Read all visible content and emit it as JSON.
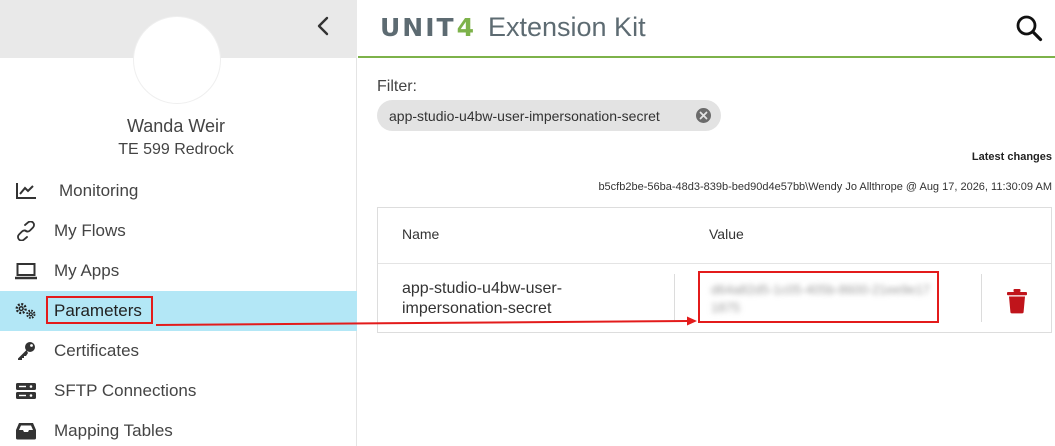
{
  "app": {
    "brand_unit": "UNIT",
    "brand_four": "4",
    "title": "Extension Kit"
  },
  "user": {
    "name": "Wanda Weir",
    "org": "TE 599 Redrock"
  },
  "nav": {
    "items": [
      {
        "label": "Monitoring",
        "icon": "chart-line-icon"
      },
      {
        "label": "My Flows",
        "icon": "link-icon"
      },
      {
        "label": "My Apps",
        "icon": "laptop-icon"
      },
      {
        "label": "Parameters",
        "icon": "gears-icon",
        "active": true
      },
      {
        "label": "Certificates",
        "icon": "key-icon"
      },
      {
        "label": "SFTP Connections",
        "icon": "server-icon"
      },
      {
        "label": "Mapping Tables",
        "icon": "tray-icon"
      }
    ]
  },
  "filter": {
    "label": "Filter:",
    "chip_value": "app-studio-u4bw-user-impersonation-secret"
  },
  "latest_changes": {
    "title": "Latest changes",
    "info": "b5cfb2be-56ba-48d3-839b-bed90d4e57bb\\Wendy Jo Allthrope @ Aug 17, 2026, 11:30:09 AM"
  },
  "table": {
    "columns": [
      "Name",
      "Value"
    ],
    "rows": [
      {
        "name": "app-studio-u4bw-user-impersonation-secret",
        "value": "d64a82d5-1c05-405b-8600-21ee9e171875"
      }
    ]
  },
  "colors": {
    "accent_green": "#7db24a",
    "active_nav": "#b3e7f6",
    "highlight_red": "#e31b1b",
    "delete_red": "#c0141b"
  }
}
